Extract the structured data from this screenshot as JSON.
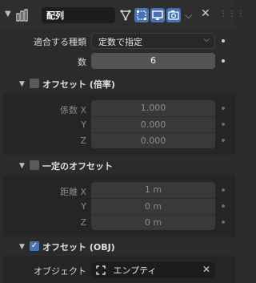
{
  "header": {
    "modifier_name": "配列",
    "toggle_icons": [
      "on-cage-icon",
      "edit-mode-icon",
      "realtime-icon",
      "render-icon"
    ]
  },
  "fit": {
    "label": "適合する種類",
    "value": "定数で指定"
  },
  "count": {
    "label": "数",
    "value": "6"
  },
  "relative_offset": {
    "title": "オフセット (倍率)",
    "enabled": false,
    "factor_label": "係数 X",
    "y_label": "Y",
    "z_label": "Z",
    "x": "1.000",
    "y": "0.000",
    "z": "0.000"
  },
  "constant_offset": {
    "title": "一定のオフセット",
    "enabled": false,
    "distance_label": "距離 X",
    "y_label": "Y",
    "z_label": "Z",
    "x": "1 m",
    "y": "0 m",
    "z": "0 m"
  },
  "object_offset": {
    "title": "オフセット (OBJ)",
    "enabled": true,
    "object_label": "オブジェクト",
    "object_value": "エンプティ"
  },
  "colors": {
    "accent": "#4772b3",
    "panel": "#2b2b2b",
    "subpanel": "#252525"
  }
}
